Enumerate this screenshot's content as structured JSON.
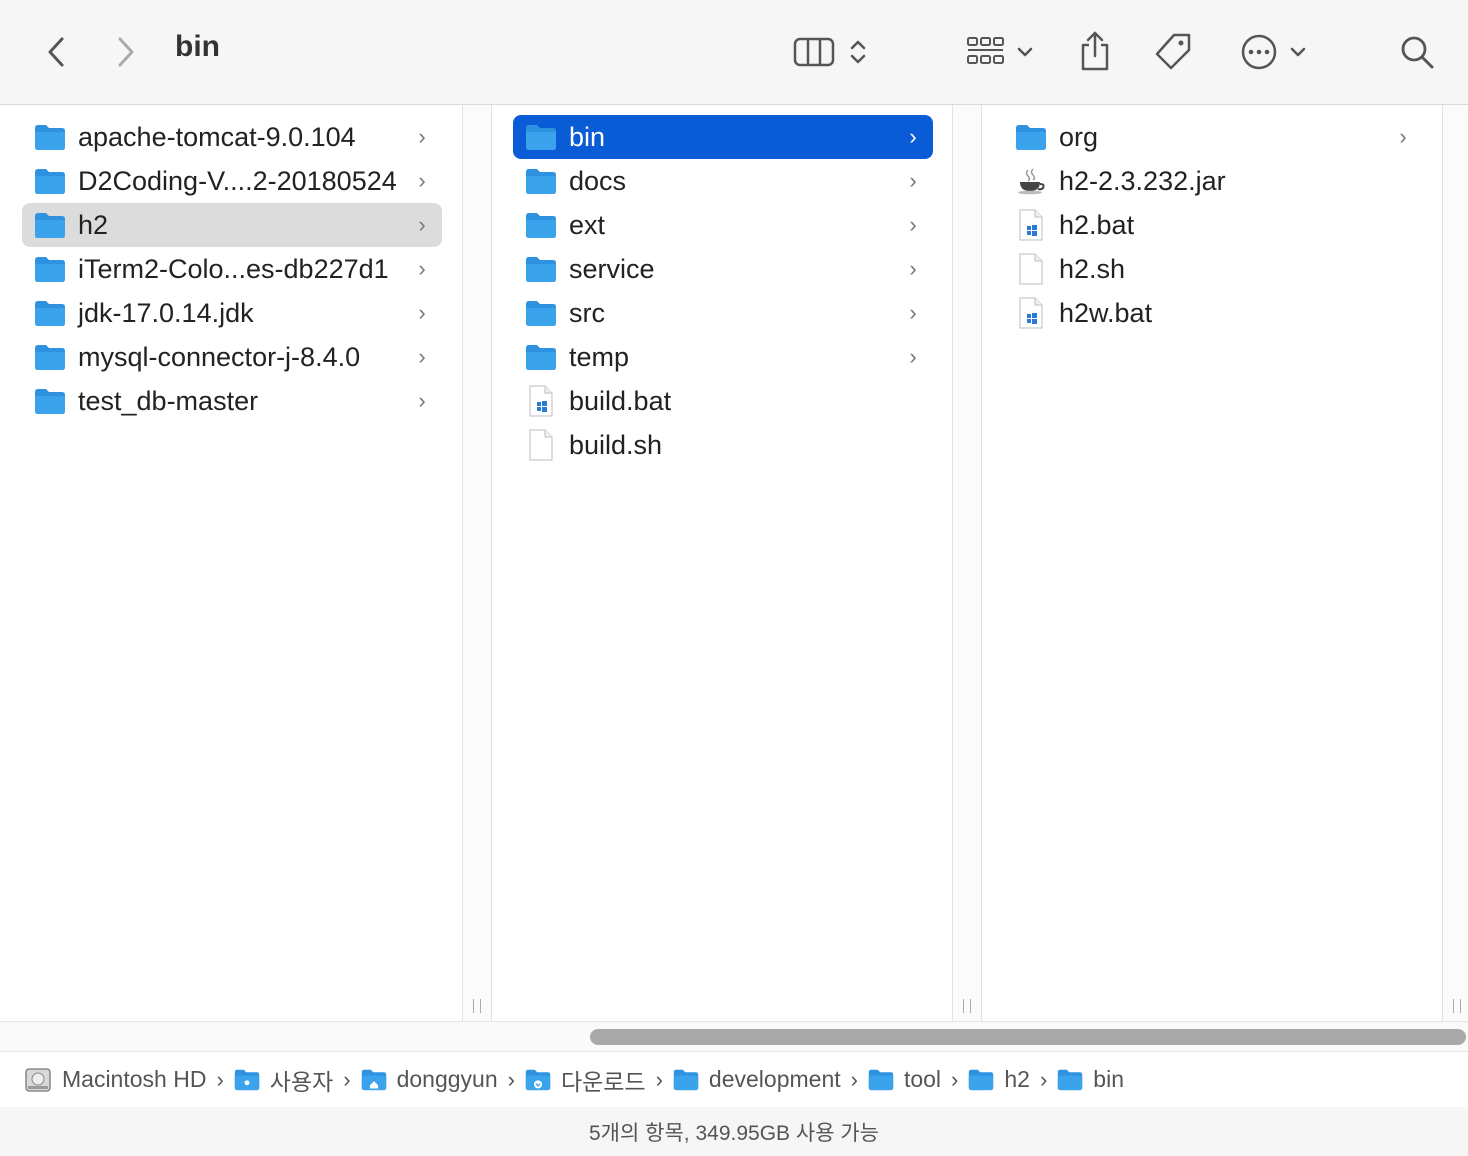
{
  "window": {
    "title": "bin"
  },
  "toolbar": {
    "back_icon": "chevron-left-icon",
    "forward_icon": "chevron-right-icon",
    "view_icon": "column-view-icon",
    "group_icon": "grid-group-icon",
    "share_icon": "share-icon",
    "tag_icon": "tag-icon",
    "more_icon": "ellipsis-circle-icon",
    "search_icon": "search-icon"
  },
  "columns": [
    {
      "items": [
        {
          "label": "apache-tomcat-9.0.104",
          "kind": "folder",
          "arrow": "›"
        },
        {
          "label": "D2Coding-V....2-20180524",
          "kind": "folder",
          "arrow": "›"
        },
        {
          "label": "h2",
          "kind": "folder",
          "arrow": "›",
          "state": "selected-inactive"
        },
        {
          "label": "iTerm2-Colo...es-db227d1",
          "kind": "folder",
          "arrow": "›"
        },
        {
          "label": "jdk-17.0.14.jdk",
          "kind": "folder",
          "arrow": "›"
        },
        {
          "label": "mysql-connector-j-8.4.0",
          "kind": "folder",
          "arrow": "›"
        },
        {
          "label": "test_db-master",
          "kind": "folder",
          "arrow": "›"
        }
      ]
    },
    {
      "items": [
        {
          "label": "bin",
          "kind": "folder",
          "arrow": "›",
          "state": "selected-active"
        },
        {
          "label": "docs",
          "kind": "folder",
          "arrow": "›"
        },
        {
          "label": "ext",
          "kind": "folder",
          "arrow": "›"
        },
        {
          "label": "service",
          "kind": "folder",
          "arrow": "›"
        },
        {
          "label": "src",
          "kind": "folder",
          "arrow": "›"
        },
        {
          "label": "temp",
          "kind": "folder",
          "arrow": "›"
        },
        {
          "label": "build.bat",
          "kind": "bat"
        },
        {
          "label": "build.sh",
          "kind": "doc"
        }
      ]
    },
    {
      "items": [
        {
          "label": "org",
          "kind": "folder",
          "arrow": "›"
        },
        {
          "label": "h2-2.3.232.jar",
          "kind": "jar"
        },
        {
          "label": "h2.bat",
          "kind": "bat"
        },
        {
          "label": "h2.sh",
          "kind": "doc"
        },
        {
          "label": "h2w.bat",
          "kind": "bat"
        }
      ]
    }
  ],
  "path": [
    {
      "label": "Macintosh HD",
      "icon": "hard-drive-icon"
    },
    {
      "label": "사용자",
      "icon": "users-folder-icon"
    },
    {
      "label": "donggyun",
      "icon": "home-folder-icon"
    },
    {
      "label": "다운로드",
      "icon": "downloads-folder-icon"
    },
    {
      "label": "development",
      "icon": "folder-icon"
    },
    {
      "label": "tool",
      "icon": "folder-icon"
    },
    {
      "label": "h2",
      "icon": "folder-icon"
    },
    {
      "label": "bin",
      "icon": "folder-icon"
    }
  ],
  "path_separator": "›",
  "status": {
    "text": "5개의 항목, 349.95GB 사용 가능"
  },
  "colors": {
    "accent": "#0a5bd6",
    "folder": "#3aa3ec",
    "selection_inactive": "#dcdcdc"
  }
}
